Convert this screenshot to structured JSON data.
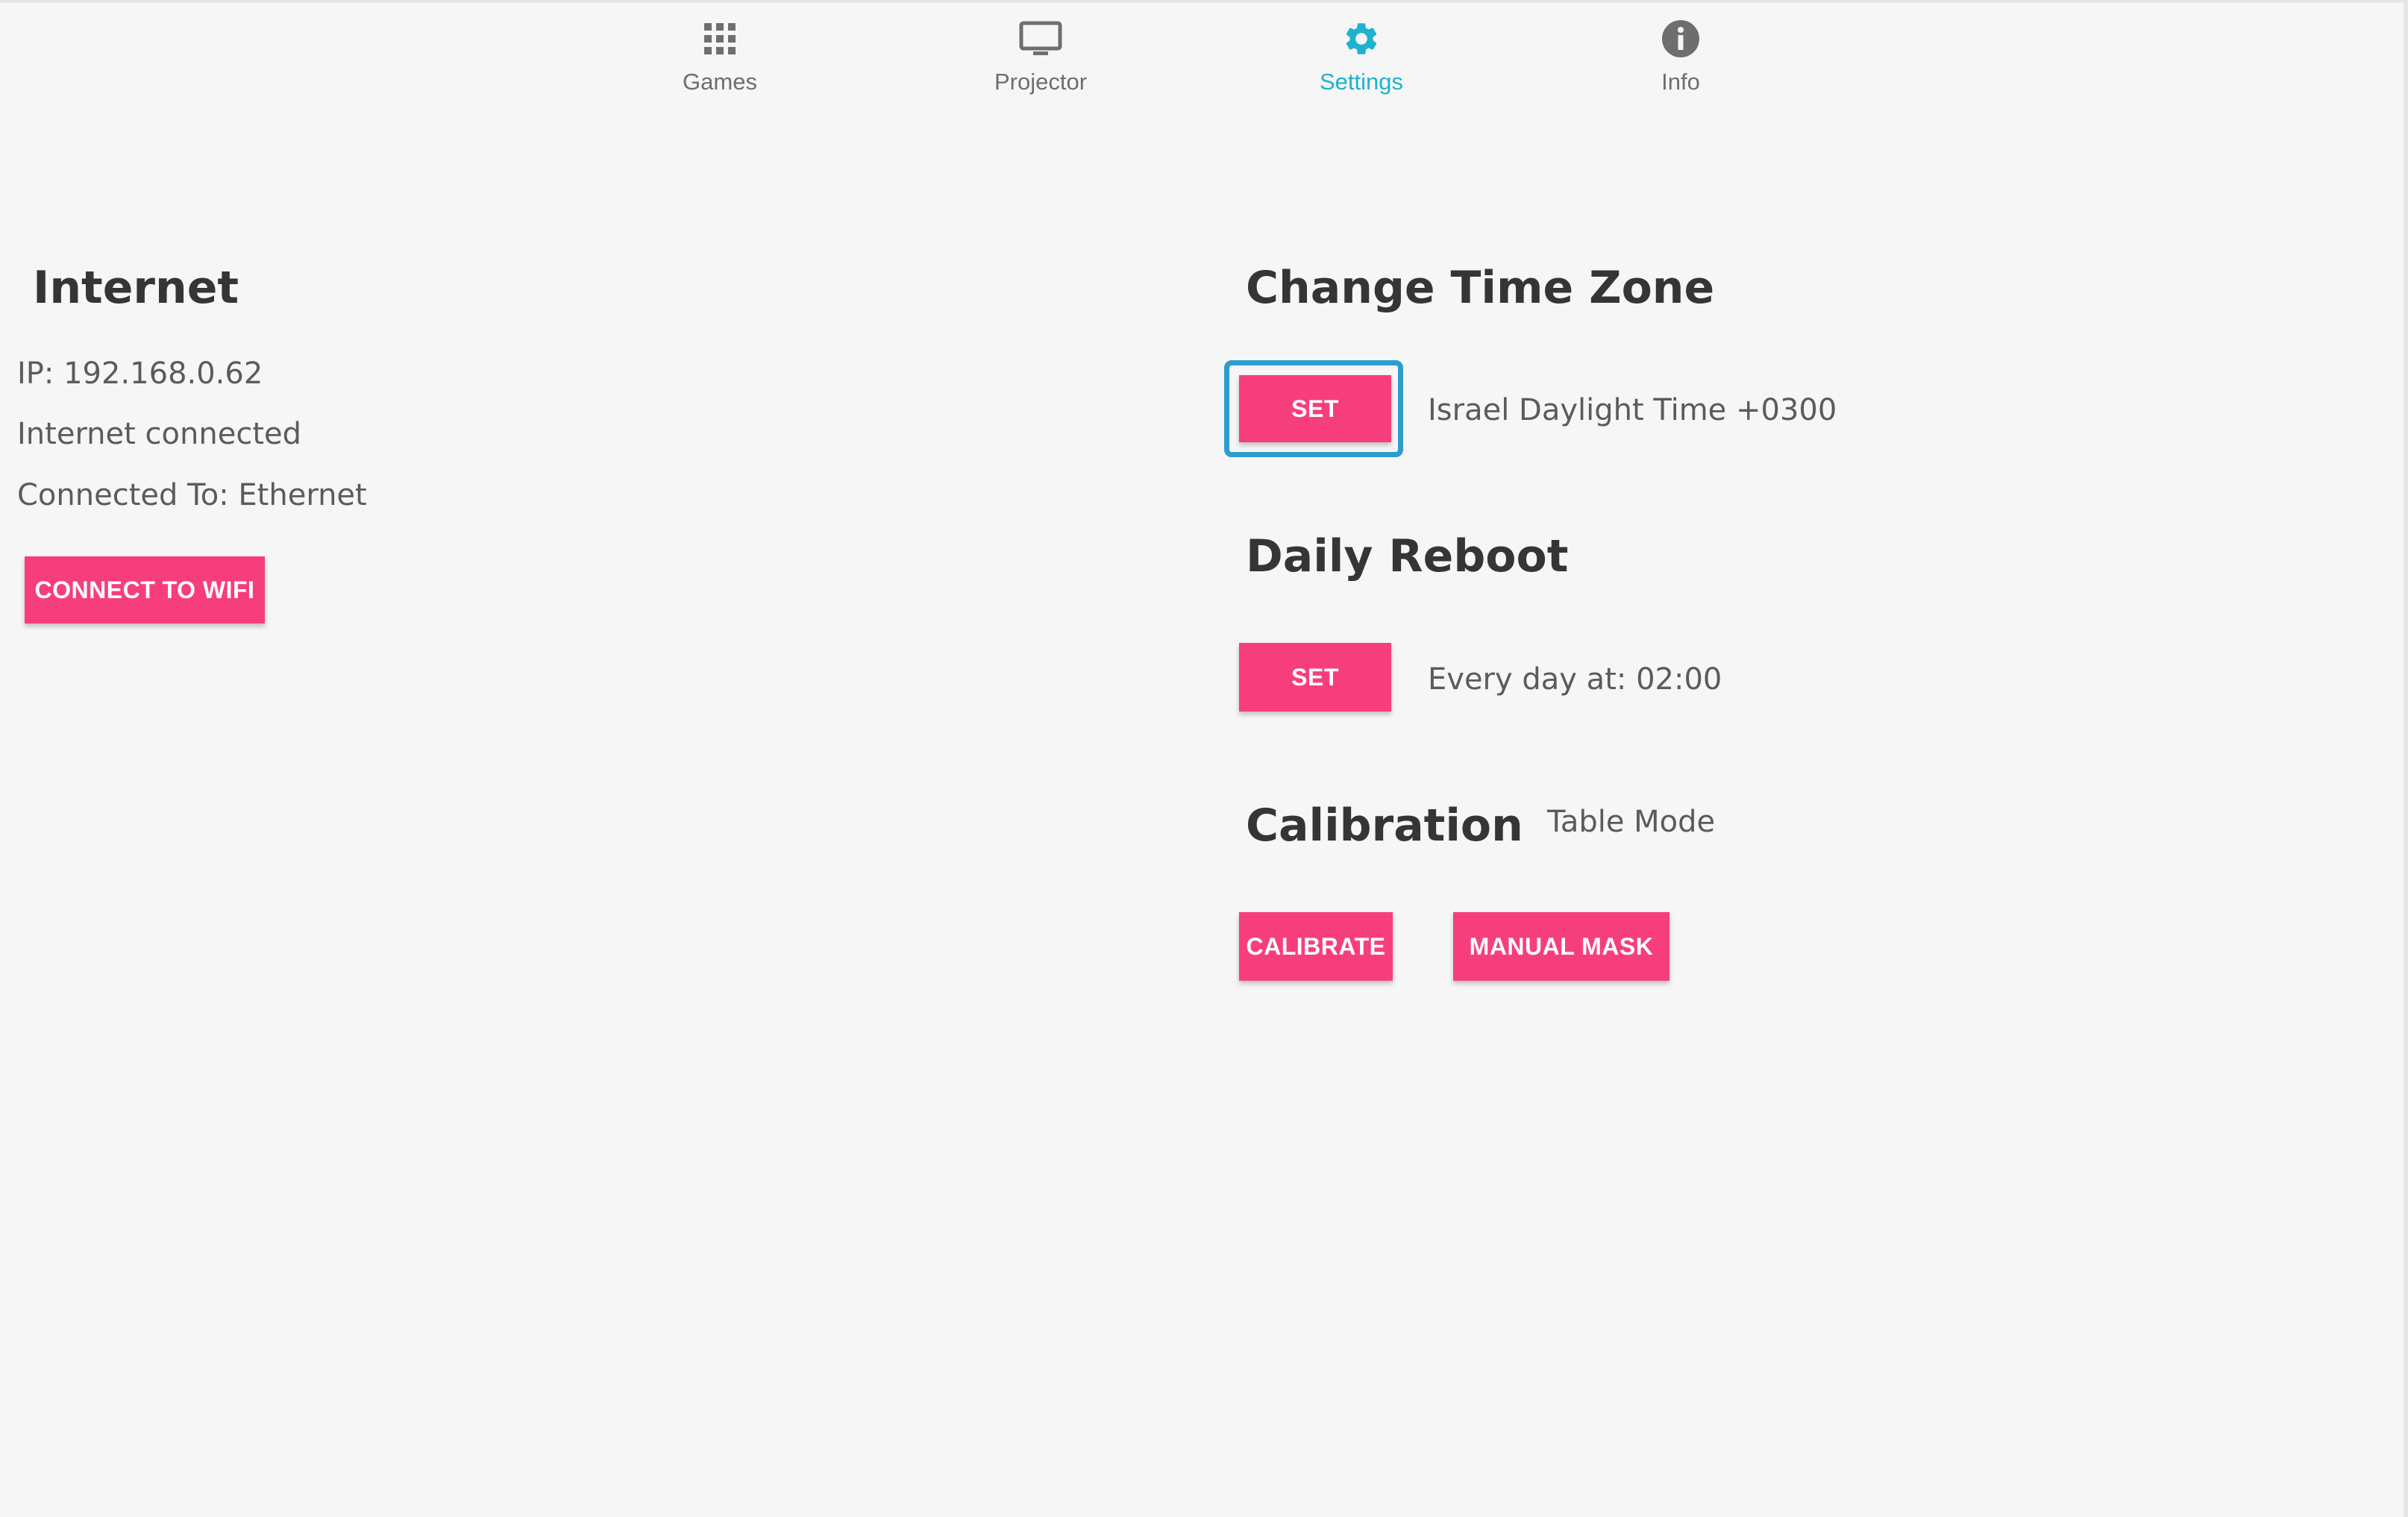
{
  "nav": {
    "items": [
      {
        "label": "Games",
        "icon": "grid-icon",
        "active": false
      },
      {
        "label": "Projector",
        "icon": "monitor-icon",
        "active": false
      },
      {
        "label": "Settings",
        "icon": "gear-icon",
        "active": true
      },
      {
        "label": "Info",
        "icon": "info-icon",
        "active": false
      }
    ]
  },
  "internet": {
    "title": "Internet",
    "ip": "IP: 192.168.0.62",
    "status": "Internet connected",
    "connected_to": "Connected To: Ethernet",
    "connect_button": "CONNECT TO WIFI"
  },
  "timezone": {
    "title": "Change Time Zone",
    "set_button": "SET",
    "value": "Israel Daylight Time +0300"
  },
  "reboot": {
    "title": "Daily Reboot",
    "set_button": "SET",
    "value": "Every day at: 02:00"
  },
  "calibration": {
    "title": "Calibration",
    "mode": "Table Mode",
    "calibrate_button": "CALIBRATE",
    "manual_mask_button": "MANUAL MASK"
  },
  "colors": {
    "accent": "#f73e7d",
    "active_tab": "#1eb2cf",
    "focus_ring": "#2c9dcf",
    "background": "#f6f6f6"
  }
}
